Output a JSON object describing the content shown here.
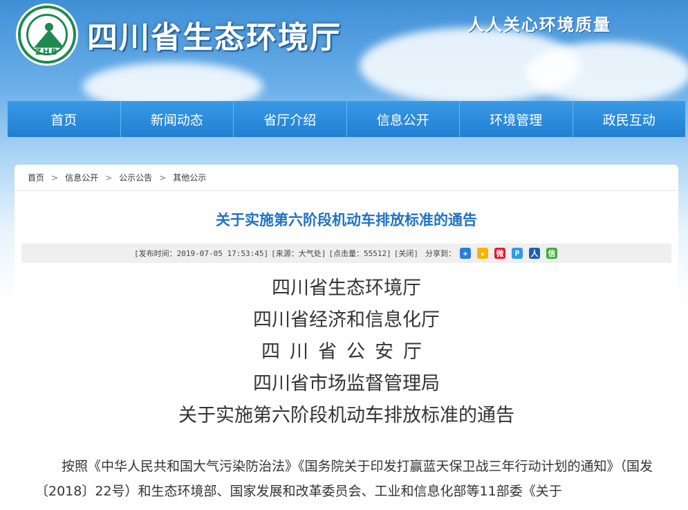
{
  "header": {
    "site_title": "四川省生态环境厅",
    "slogan": "人人关心环境质量",
    "logo_text": "ZHB"
  },
  "nav": {
    "items": [
      {
        "label": "首页"
      },
      {
        "label": "新闻动态"
      },
      {
        "label": "省厅介绍"
      },
      {
        "label": "信息公开"
      },
      {
        "label": "环境管理"
      },
      {
        "label": "政民互动"
      }
    ]
  },
  "breadcrumb": {
    "items": [
      "首页",
      "信息公开",
      "公示公告",
      "其他公示"
    ],
    "separator": ">"
  },
  "article": {
    "title": "关于实施第六阶段机动车排放标准的通告",
    "meta": {
      "publish_time": "[发布时间：2019-07-05 17:53:45]",
      "source": "[来源：大气处]",
      "hits": "[点击量：55512]",
      "close": "[关闭]",
      "share_label": "分享到："
    },
    "share_icons": [
      {
        "name": "plus-share-icon",
        "color": "#2b7fd8",
        "glyph": "+"
      },
      {
        "name": "qzone-share-icon",
        "color": "#f4b400",
        "glyph": "★"
      },
      {
        "name": "weibo-share-icon",
        "color": "#e6162d",
        "glyph": "微"
      },
      {
        "name": "tencent-share-icon",
        "color": "#2e9be6",
        "glyph": "P"
      },
      {
        "name": "renren-share-icon",
        "color": "#1a5eb4",
        "glyph": "人"
      },
      {
        "name": "wechat-share-icon",
        "color": "#3cb034",
        "glyph": "信"
      }
    ],
    "issuers": [
      "四川省生态环境厅",
      "四川省经济和信息化厅",
      "四川省公安厅",
      "四川省市场监督管理局",
      "关于实施第六阶段机动车排放标准的通告"
    ],
    "body": "按照《中华人民共和国大气污染防治法》《国务院关于印发打赢蓝天保卫战三年行动计划的通知》（国发〔2018〕22号）和生态环境部、国家发展和改革委员会、工业和信息化部等11部委《关于"
  }
}
